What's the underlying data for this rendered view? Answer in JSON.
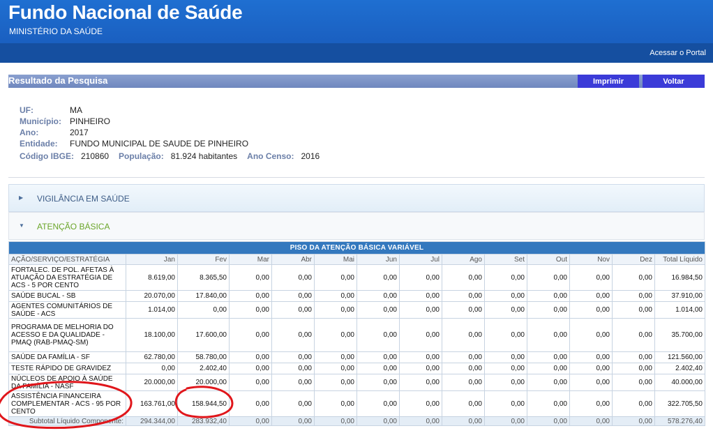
{
  "header": {
    "title": "Fundo Nacional de Saúde",
    "subtitle": "MINISTÉRIO DA SAÚDE",
    "portal_link": "Acessar o Portal"
  },
  "result": {
    "title": "Resultado da Pesquisa",
    "print_label": "Imprimir",
    "back_label": "Voltar"
  },
  "info": {
    "uf_label": "UF:",
    "uf_value": "MA",
    "municipio_label": "Município:",
    "municipio_value": "PINHEIRO",
    "ano_label": "Ano:",
    "ano_value": "2017",
    "entidade_label": "Entidade:",
    "entidade_value": "FUNDO MUNICIPAL DE SAUDE DE PINHEIRO",
    "ibge_label": "Código IBGE:",
    "ibge_value": "210860",
    "populacao_label": "População:",
    "populacao_value": "81.924 habitantes",
    "censo_label": "Ano Censo:",
    "censo_value": "2016"
  },
  "accordion": [
    {
      "title": "VIGILÂNCIA EM SAÚDE",
      "expanded": false
    },
    {
      "title": "ATENÇÃO BÁSICA",
      "expanded": true
    }
  ],
  "table": {
    "caption": "PISO DA ATENÇÃO BÁSICA VARIÁVEL",
    "columns": [
      "AÇÃO/SERVIÇO/ESTRATÉGIA",
      "Jan",
      "Fev",
      "Mar",
      "Abr",
      "Mai",
      "Jun",
      "Jul",
      "Ago",
      "Set",
      "Out",
      "Nov",
      "Dez",
      "Total Líquido"
    ],
    "rows": [
      {
        "name": "FORTALEC. DE POL. AFETAS À ATUAÇÃO DA ESTRATÉGIA DE ACS - 5 POR CENTO",
        "jan": "8.619,00",
        "fev": "8.365,50",
        "mar": "0,00",
        "abr": "0,00",
        "mai": "0,00",
        "jun": "0,00",
        "jul": "0,00",
        "ago": "0,00",
        "set": "0,00",
        "out": "0,00",
        "nov": "0,00",
        "dez": "0,00",
        "total": "16.984,50"
      },
      {
        "name": "SAÚDE BUCAL - SB",
        "jan": "20.070,00",
        "fev": "17.840,00",
        "mar": "0,00",
        "abr": "0,00",
        "mai": "0,00",
        "jun": "0,00",
        "jul": "0,00",
        "ago": "0,00",
        "set": "0,00",
        "out": "0,00",
        "nov": "0,00",
        "dez": "0,00",
        "total": "37.910,00"
      },
      {
        "name": "AGENTES COMUNITÁRIOS DE SAÚDE - ACS",
        "jan": "1.014,00",
        "fev": "0,00",
        "mar": "0,00",
        "abr": "0,00",
        "mai": "0,00",
        "jun": "0,00",
        "jul": "0,00",
        "ago": "0,00",
        "set": "0,00",
        "out": "0,00",
        "nov": "0,00",
        "dez": "0,00",
        "total": "1.014,00"
      },
      {
        "name": "PROGRAMA DE MELHORIA DO ACESSO E DA QUALIDADE - PMAQ (RAB-PMAQ-SM)",
        "jan": "18.100,00",
        "fev": "17.600,00",
        "mar": "0,00",
        "abr": "0,00",
        "mai": "0,00",
        "jun": "0,00",
        "jul": "0,00",
        "ago": "0,00",
        "set": "0,00",
        "out": "0,00",
        "nov": "0,00",
        "dez": "0,00",
        "total": "35.700,00"
      },
      {
        "name": "SAÚDE DA FAMÍLIA - SF",
        "jan": "62.780,00",
        "fev": "58.780,00",
        "mar": "0,00",
        "abr": "0,00",
        "mai": "0,00",
        "jun": "0,00",
        "jul": "0,00",
        "ago": "0,00",
        "set": "0,00",
        "out": "0,00",
        "nov": "0,00",
        "dez": "0,00",
        "total": "121.560,00"
      },
      {
        "name": "TESTE RÁPIDO DE GRAVIDEZ",
        "jan": "0,00",
        "fev": "2.402,40",
        "mar": "0,00",
        "abr": "0,00",
        "mai": "0,00",
        "jun": "0,00",
        "jul": "0,00",
        "ago": "0,00",
        "set": "0,00",
        "out": "0,00",
        "nov": "0,00",
        "dez": "0,00",
        "total": "2.402,40"
      },
      {
        "name": "NÚCLEOS DE APOIO À SAÚDE DA FAMÍLIA - NASF",
        "jan": "20.000,00",
        "fev": "20.000,00",
        "mar": "0,00",
        "abr": "0,00",
        "mai": "0,00",
        "jun": "0,00",
        "jul": "0,00",
        "ago": "0,00",
        "set": "0,00",
        "out": "0,00",
        "nov": "0,00",
        "dez": "0,00",
        "total": "40.000,00"
      },
      {
        "name": "ASSISTÊNCIA FINANCEIRA COMPLEMENTAR - ACS - 95 POR CENTO",
        "jan": "163.761,00",
        "fev": "158.944,50",
        "mar": "0,00",
        "abr": "0,00",
        "mai": "0,00",
        "jun": "0,00",
        "jul": "0,00",
        "ago": "0,00",
        "set": "0,00",
        "out": "0,00",
        "nov": "0,00",
        "dez": "0,00",
        "total": "322.705,50"
      }
    ],
    "subtotal": {
      "name": "Subtotal Líquido Componente:",
      "jan": "294.344,00",
      "fev": "283.932,40",
      "mar": "0,00",
      "abr": "0,00",
      "mai": "0,00",
      "jun": "0,00",
      "jul": "0,00",
      "ago": "0,00",
      "set": "0,00",
      "out": "0,00",
      "nov": "0,00",
      "dez": "0,00",
      "total": "578.276,40"
    }
  },
  "colors": {
    "header_blue": "#1f6fd1",
    "nav_blue": "#154fa0",
    "button_blue": "#3b3bd8",
    "label_gray_blue": "#6b7fa8",
    "table_caption": "#3378be",
    "annotation_red": "#e0161b",
    "expanded_green": "#6aa528"
  },
  "icons": {
    "collapsed": "triangle-right-icon",
    "expanded": "triangle-down-icon"
  }
}
